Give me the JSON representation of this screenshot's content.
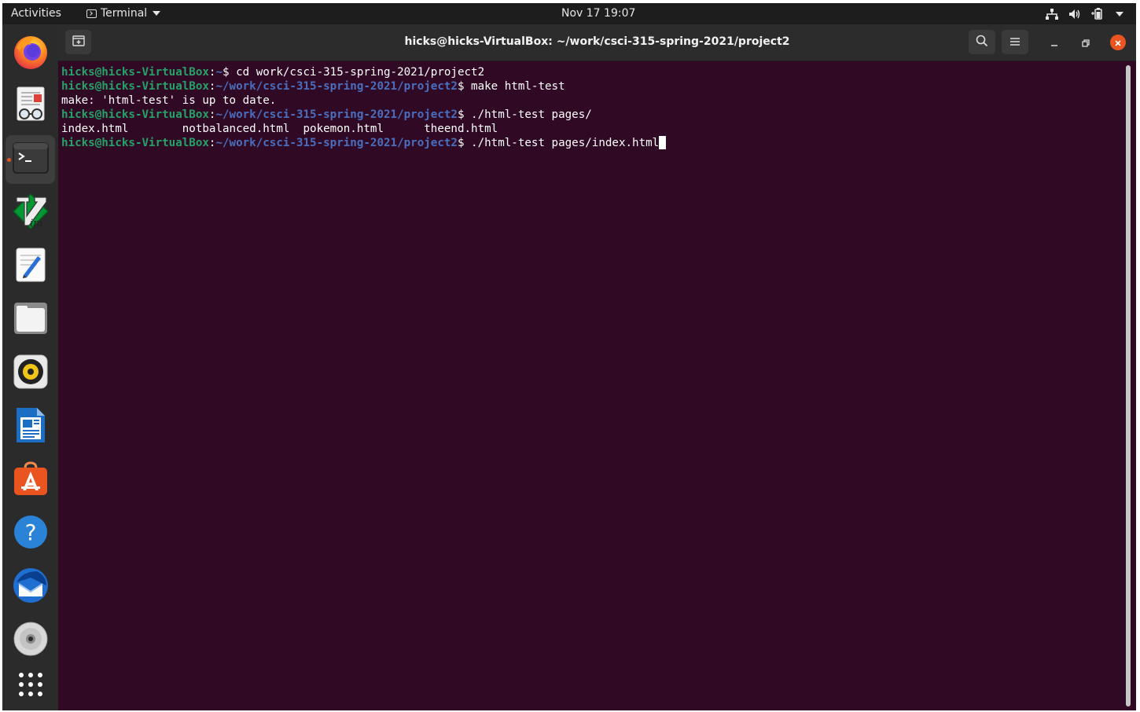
{
  "topbar": {
    "activities": "Activities",
    "app_name": "Terminal",
    "clock": "Nov 17  19:07"
  },
  "dock": {
    "items": [
      {
        "name": "firefox-icon"
      },
      {
        "name": "document-viewer-icon"
      },
      {
        "name": "terminal-icon",
        "active": true
      },
      {
        "name": "vim-icon"
      },
      {
        "name": "text-editor-icon"
      },
      {
        "name": "files-icon"
      },
      {
        "name": "rhythmbox-icon"
      },
      {
        "name": "libreoffice-writer-icon"
      },
      {
        "name": "software-center-icon"
      },
      {
        "name": "help-icon"
      },
      {
        "name": "thunderbird-icon"
      },
      {
        "name": "dvd-icon"
      },
      {
        "name": "show-apps-icon"
      }
    ]
  },
  "window": {
    "title": "hicks@hicks-VirtualBox: ~/work/csci-315-spring-2021/project2"
  },
  "terminal": {
    "user_host": "hicks@hicks-VirtualBox",
    "lines": [
      {
        "type": "prompt",
        "path": "~",
        "cmd": "cd work/csci-315-spring-2021/project2"
      },
      {
        "type": "prompt",
        "path": "~/work/csci-315-spring-2021/project2",
        "cmd": "make html-test"
      },
      {
        "type": "output",
        "text": "make: 'html-test' is up to date."
      },
      {
        "type": "prompt",
        "path": "~/work/csci-315-spring-2021/project2",
        "cmd": "./html-test pages/"
      },
      {
        "type": "output",
        "text": "index.html        notbalanced.html  pokemon.html      theend.html"
      },
      {
        "type": "prompt",
        "path": "~/work/csci-315-spring-2021/project2",
        "cmd": "./html-test pages/index.html",
        "cursor": true
      }
    ]
  },
  "colors": {
    "terminal_bg": "#300a24",
    "prompt_user": "#26a269",
    "prompt_path": "#4a6fbf",
    "accent": "#e95420"
  }
}
